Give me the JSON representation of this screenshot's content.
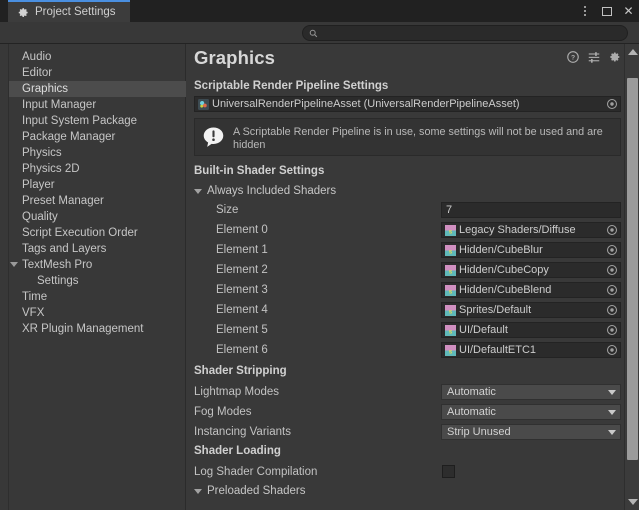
{
  "window": {
    "tab_label": "Project Settings",
    "tab_icon": "gear-icon",
    "controls": {
      "menu": "kebab-menu-icon",
      "maximize": "maximize-icon",
      "close": "close-icon",
      "close_glyph": "✕"
    },
    "accent_color": "#4a8fe0"
  },
  "search": {
    "value": "",
    "placeholder": "",
    "icon": "search-icon"
  },
  "sidebar": {
    "items": [
      {
        "label": "Audio",
        "level": 0,
        "selected": false,
        "foldout": null
      },
      {
        "label": "Editor",
        "level": 0,
        "selected": false,
        "foldout": null
      },
      {
        "label": "Graphics",
        "level": 0,
        "selected": true,
        "foldout": null
      },
      {
        "label": "Input Manager",
        "level": 0,
        "selected": false,
        "foldout": null
      },
      {
        "label": "Input System Package",
        "level": 0,
        "selected": false,
        "foldout": null
      },
      {
        "label": "Package Manager",
        "level": 0,
        "selected": false,
        "foldout": null
      },
      {
        "label": "Physics",
        "level": 0,
        "selected": false,
        "foldout": null
      },
      {
        "label": "Physics 2D",
        "level": 0,
        "selected": false,
        "foldout": null
      },
      {
        "label": "Player",
        "level": 0,
        "selected": false,
        "foldout": null
      },
      {
        "label": "Preset Manager",
        "level": 0,
        "selected": false,
        "foldout": null
      },
      {
        "label": "Quality",
        "level": 0,
        "selected": false,
        "foldout": null
      },
      {
        "label": "Script Execution Order",
        "level": 0,
        "selected": false,
        "foldout": null
      },
      {
        "label": "Tags and Layers",
        "level": 0,
        "selected": false,
        "foldout": null
      },
      {
        "label": "TextMesh Pro",
        "level": 0,
        "selected": false,
        "foldout": "expanded"
      },
      {
        "label": "Settings",
        "level": 1,
        "selected": false,
        "foldout": null
      },
      {
        "label": "Time",
        "level": 0,
        "selected": false,
        "foldout": null
      },
      {
        "label": "VFX",
        "level": 0,
        "selected": false,
        "foldout": null
      },
      {
        "label": "XR Plugin Management",
        "level": 0,
        "selected": false,
        "foldout": null
      }
    ]
  },
  "main": {
    "title": "Graphics",
    "header_icons": [
      {
        "name": "help-icon",
        "glyph": "?"
      },
      {
        "name": "preset-icon",
        "glyph": ""
      },
      {
        "name": "settings-gear-icon",
        "glyph": ""
      }
    ],
    "srp": {
      "label": "Scriptable Render Pipeline Settings",
      "value": "UniversalRenderPipelineAsset (UniversalRenderPipelineAsset)",
      "icon": "render-pipeline-asset-icon",
      "picker": "object-picker-icon"
    },
    "helpbox": {
      "icon": "info-balloon-icon",
      "text": "A Scriptable Render Pipeline is in use, some settings will not be used and are hidden"
    },
    "builtin_shader_settings": {
      "header": "Built-in Shader Settings",
      "always_included": {
        "label": "Always Included Shaders",
        "expanded": true,
        "size_label": "Size",
        "size_value": "7",
        "elements": [
          {
            "label": "Element 0",
            "value": "Legacy Shaders/Diffuse",
            "icon": "shader-icon"
          },
          {
            "label": "Element 1",
            "value": "Hidden/CubeBlur",
            "icon": "shader-icon"
          },
          {
            "label": "Element 2",
            "value": "Hidden/CubeCopy",
            "icon": "shader-icon"
          },
          {
            "label": "Element 3",
            "value": "Hidden/CubeBlend",
            "icon": "shader-icon"
          },
          {
            "label": "Element 4",
            "value": "Sprites/Default",
            "icon": "shader-icon"
          },
          {
            "label": "Element 5",
            "value": "UI/Default",
            "icon": "shader-icon"
          },
          {
            "label": "Element 6",
            "value": "UI/DefaultETC1",
            "icon": "shader-icon"
          }
        ]
      }
    },
    "shader_stripping": {
      "header": "Shader Stripping",
      "rows": [
        {
          "label": "Lightmap Modes",
          "value": "Automatic"
        },
        {
          "label": "Fog Modes",
          "value": "Automatic"
        },
        {
          "label": "Instancing Variants",
          "value": "Strip Unused"
        }
      ]
    },
    "shader_loading": {
      "header": "Shader Loading",
      "log_shader_compilation": {
        "label": "Log Shader Compilation",
        "checked": false
      },
      "preloaded_shaders": {
        "label": "Preloaded Shaders",
        "expanded": true
      }
    }
  },
  "scrollbar": {
    "up_arrow": "scroll-up-arrow",
    "down_arrow": "scroll-down-arrow",
    "thumb": "scroll-thumb"
  }
}
